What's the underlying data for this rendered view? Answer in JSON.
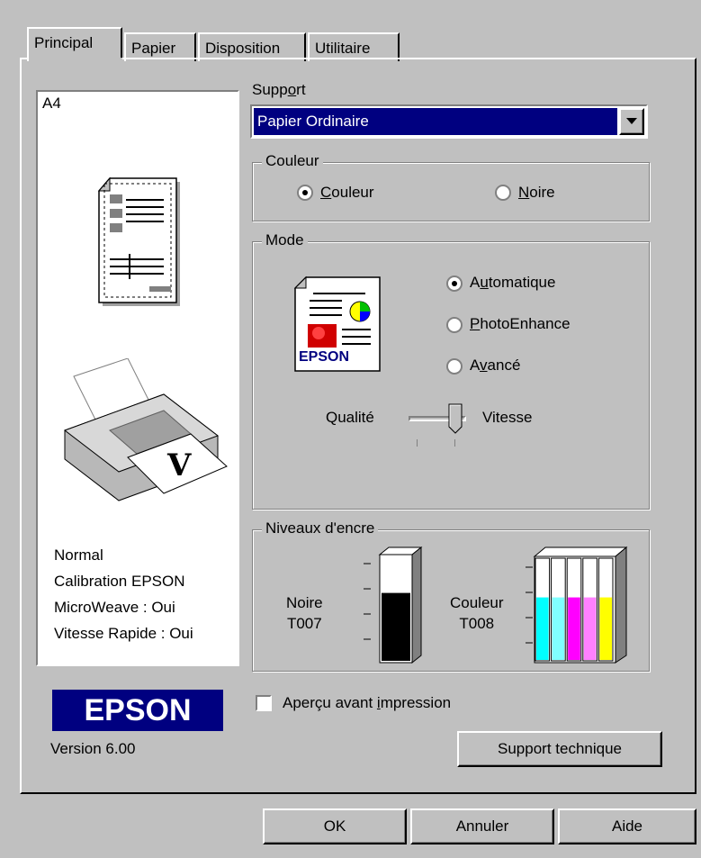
{
  "tabs": [
    {
      "label": "Principal"
    },
    {
      "label": "Papier"
    },
    {
      "label": "Disposition"
    },
    {
      "label": "Utilitaire"
    }
  ],
  "preview": {
    "paper_size": "A4",
    "status_lines": [
      "Normal",
      "Calibration EPSON",
      "MicroWeave : Oui",
      "Vitesse Rapide : Oui"
    ]
  },
  "brand": {
    "logo_text": "EPSON",
    "version": "Version 6.00",
    "logo_color": "#000080"
  },
  "support": {
    "label_pre": "Supp",
    "label_ul": "o",
    "label_post": "rt",
    "selected": "Papier Ordinaire"
  },
  "couleur_group": {
    "title": "Couleur",
    "options": [
      {
        "ul": "C",
        "rest": "ouleur",
        "selected": true
      },
      {
        "ul": "N",
        "rest": "oire",
        "selected": false
      }
    ]
  },
  "mode_group": {
    "title": "Mode",
    "icon_text": "EPSON",
    "options": [
      {
        "pre": "A",
        "ul": "u",
        "rest": "tomatique",
        "selected": true
      },
      {
        "pre": "",
        "ul": "P",
        "rest": "hotoEnhance",
        "selected": false
      },
      {
        "pre": "A",
        "ul": "v",
        "rest": "ancé",
        "selected": false
      }
    ],
    "slider": {
      "left_label": "Qualité",
      "right_label": "Vitesse",
      "value": 1,
      "max": 1
    }
  },
  "ink_group": {
    "title": "Niveaux d'encre",
    "black": {
      "name": "Noire",
      "code": "T007",
      "level": 0.65
    },
    "color": {
      "name": "Couleur",
      "code": "T008",
      "level": 0.62,
      "colors": [
        "#00ffff",
        "#80ffff",
        "#ff00ff",
        "#ff80ff",
        "#ffff00"
      ]
    }
  },
  "preview_checkbox": {
    "pre": "Aperçu avant ",
    "ul": "i",
    "rest": "mpression",
    "checked": false
  },
  "buttons": {
    "support_technique": "Support technique",
    "ok": "OK",
    "annuler": "Annuler",
    "aide": "Aide"
  }
}
